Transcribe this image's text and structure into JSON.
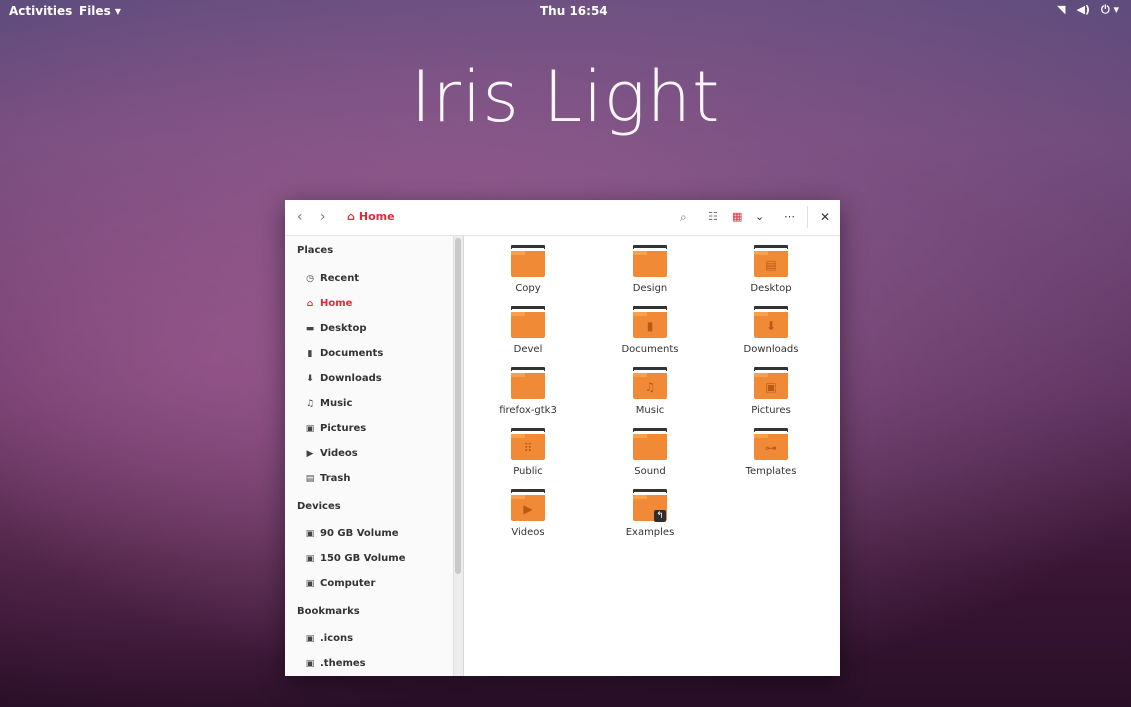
{
  "topbar": {
    "activities": "Activities",
    "app_menu": "Files ▾",
    "clock": "Thu 16:54"
  },
  "hero_title": "Iris Light",
  "header": {
    "breadcrumb": "Home"
  },
  "sidebar": {
    "places_title": "Places",
    "places": [
      "Recent",
      "Home",
      "Desktop",
      "Documents",
      "Downloads",
      "Music",
      "Pictures",
      "Videos",
      "Trash"
    ],
    "devices_title": "Devices",
    "devices": [
      "90 GB Volume",
      "150 GB Volume",
      "Computer"
    ],
    "bookmarks_title": "Bookmarks",
    "bookmarks": [
      ".icons",
      ".themes"
    ]
  },
  "files": [
    "Copy",
    "Design",
    "Desktop",
    "Devel",
    "Documents",
    "Downloads",
    "firefox-gtk3",
    "Music",
    "Pictures",
    "Public",
    "Sound",
    "Templates",
    "Videos",
    "Examples"
  ],
  "colors": {
    "accent": "#e02a3a",
    "folder": "#f08a37"
  }
}
